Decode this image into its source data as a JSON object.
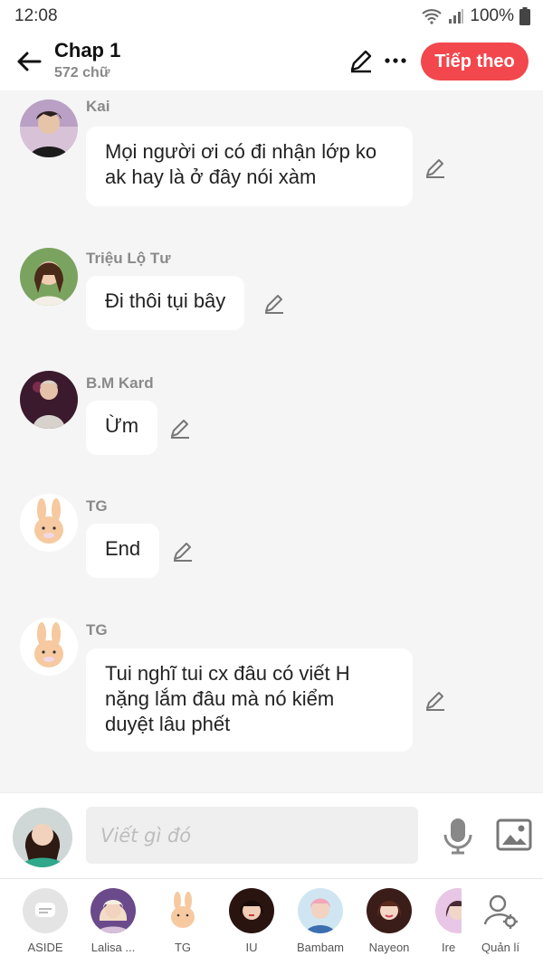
{
  "status": {
    "time": "12:08",
    "battery": "100%"
  },
  "header": {
    "title": "Chap 1",
    "subtitle": "572 chữ",
    "next_label": "Tiếp theo"
  },
  "messages": [
    {
      "sender": "Kai",
      "text": "Mọi người ơi có đi nhận lớp ko\nak hay là ở đây nói xàm"
    },
    {
      "sender": "Triệu Lộ Tư",
      "text": "Đi thôi tụi bây"
    },
    {
      "sender": "B.M Kard",
      "text": "Ừm"
    },
    {
      "sender": "TG",
      "text": "End"
    },
    {
      "sender": "TG",
      "text": "Tui nghĩ tui cx đâu có viết H\nnặng lắm đâu mà nó kiểm\nduyệt lâu phết"
    }
  ],
  "composer": {
    "placeholder": "Viết gì đó"
  },
  "characters": [
    {
      "name": "ASIDE"
    },
    {
      "name": "Lalisa ..."
    },
    {
      "name": "TG"
    },
    {
      "name": "IU"
    },
    {
      "name": "Bambam"
    },
    {
      "name": "Nayeon"
    },
    {
      "name": "Ire"
    },
    {
      "name": "Quản lí"
    }
  ],
  "colors": {
    "accent": "#f2474c",
    "background": "#f5f5f5",
    "bubble": "#ffffff"
  }
}
